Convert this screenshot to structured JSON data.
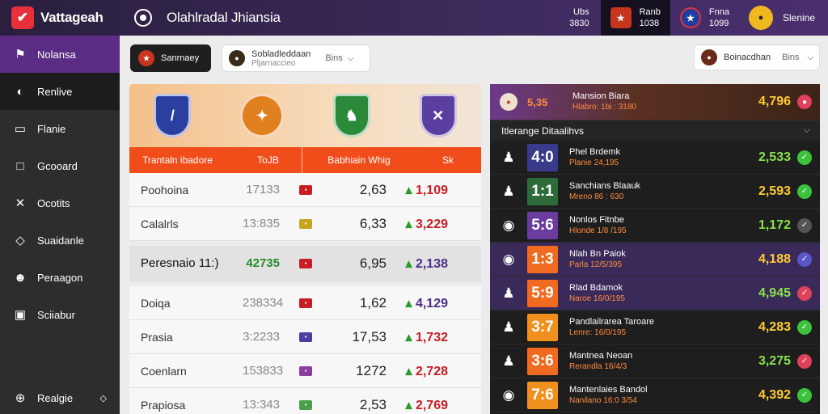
{
  "header": {
    "brand": "Vattageah",
    "title": "Olahlradal Jhiansia",
    "mini1": [
      "Ubs",
      "3830"
    ],
    "match1": [
      "Ranb",
      "1038"
    ],
    "match2": [
      "Fnna",
      "1099"
    ],
    "user": "Slenine"
  },
  "sidebar": {
    "items": [
      {
        "label": "Nolansa",
        "icon": "flag-icon"
      },
      {
        "label": "Renlive",
        "icon": "ball-icon"
      },
      {
        "label": "Flanie",
        "icon": "monitor-icon"
      },
      {
        "label": "Gcooard",
        "icon": "screen-icon"
      },
      {
        "label": "Ocotits",
        "icon": "tools-icon"
      },
      {
        "label": "Suaidanle",
        "icon": "shield-icon"
      },
      {
        "label": "Peraagon",
        "icon": "users-icon"
      },
      {
        "label": "Sciiabur",
        "icon": "car-icon"
      }
    ],
    "bottom_label": "Realgie"
  },
  "filters": {
    "dark_label": "Sanrnaey",
    "light_title": "Sobladleddaan",
    "light_sub": "Pljarnaccieo",
    "light_value": "Bins",
    "right_label": "Boinacdhan",
    "right_value": "Bins"
  },
  "table": {
    "headers": [
      "Trantaln ibadore",
      "ToJB",
      "Babhiain Whig",
      "Sk"
    ],
    "groups": [
      [
        {
          "name": "Poohoina",
          "val": "17133",
          "odd": "2,63",
          "change": "1,109",
          "change_color": "#c81d25",
          "flag": "#c81d25"
        },
        {
          "name": "Calalrls",
          "val": "13:835",
          "odd": "6,33",
          "change": "3,229",
          "change_color": "#c81d25",
          "flag": "#c8a41d"
        }
      ],
      [
        {
          "name": "Peresnaio 11:)",
          "val": "42735",
          "odd": "6,95",
          "change": "2,138",
          "change_color": "#4a2f8a",
          "flag": "#c81d25",
          "highlight": true
        }
      ],
      [
        {
          "name": "Doiqa",
          "val": "238334",
          "odd": "1,62",
          "change": "4,129",
          "change_color": "#4a2f8a",
          "flag": "#c81d25"
        },
        {
          "name": "Prasia",
          "val": "3:2233",
          "odd": "17,53",
          "change": "1,732",
          "change_color": "#c81d25",
          "flag": "#4a3fa0"
        },
        {
          "name": "Coenlarn",
          "val": "153833",
          "odd": "1272",
          "change": "2,728",
          "change_color": "#c81d25",
          "flag": "#8a3fa0"
        },
        {
          "name": "Prapiosa",
          "val": "13:343",
          "odd": "2,53",
          "change": "2,769",
          "change_color": "#c81d25",
          "flag": "#4aa04a"
        }
      ]
    ]
  },
  "featured": {
    "score": "5,35",
    "title": "Mansion Biara",
    "sub": "Hlabro: 1bi : 3180",
    "odd": "4,796"
  },
  "section_title": "Itlerange Ditaalihvs",
  "matches": [
    {
      "score": "4:0",
      "title": "Phel Brdemk",
      "sub": "Planie 24,195",
      "odd": "2,533",
      "tile": "#3a3a8a",
      "dot": "#3cc23c",
      "icon": "player-icon"
    },
    {
      "score": "1:1",
      "title": "Sanchians Blaauk",
      "sub": "Mreno 86 : 630",
      "odd": "2,593",
      "tile": "#2e6b3a",
      "dot": "#3cc23c",
      "icon": "player-icon"
    },
    {
      "score": "5:6",
      "title": "Nonlos Fitnbe",
      "sub": "Hlonde 1/8 /195",
      "odd": "1,172",
      "tile": "#6a3ca0",
      "dot": "#555555",
      "icon": "ball-icon"
    },
    {
      "score": "1:3",
      "title": "Nlah Bn Paiok",
      "sub": "Parla 12/5/395",
      "odd": "4,188",
      "tile": "#f06a1f",
      "dot": "#5a55c8",
      "icon": "ball-icon"
    },
    {
      "score": "5:9",
      "title": "Rlad Bdamok",
      "sub": "Naroe 16/0/195",
      "odd": "4,945",
      "tile": "#f06a1f",
      "dot": "#e0405a",
      "icon": "player-icon"
    },
    {
      "score": "3:7",
      "title": "Pandlailrarea Taroare",
      "sub": "Lenre: 16/0/195",
      "odd": "4,283",
      "tile": "#f0901f",
      "dot": "#3cc23c",
      "icon": "player-icon"
    },
    {
      "score": "3:6",
      "title": "Mantnea Neoan",
      "sub": "Rerandla 16/4/3",
      "odd": "3,275",
      "tile": "#f06a1f",
      "dot": "#e0405a",
      "icon": "player-icon"
    },
    {
      "score": "7:6",
      "title": "Mantenlaies Bandol",
      "sub": "Nanilano 16:0 3/54",
      "odd": "4,392",
      "tile": "#f0901f",
      "dot": "#3cc23c",
      "icon": "ball-icon"
    }
  ]
}
